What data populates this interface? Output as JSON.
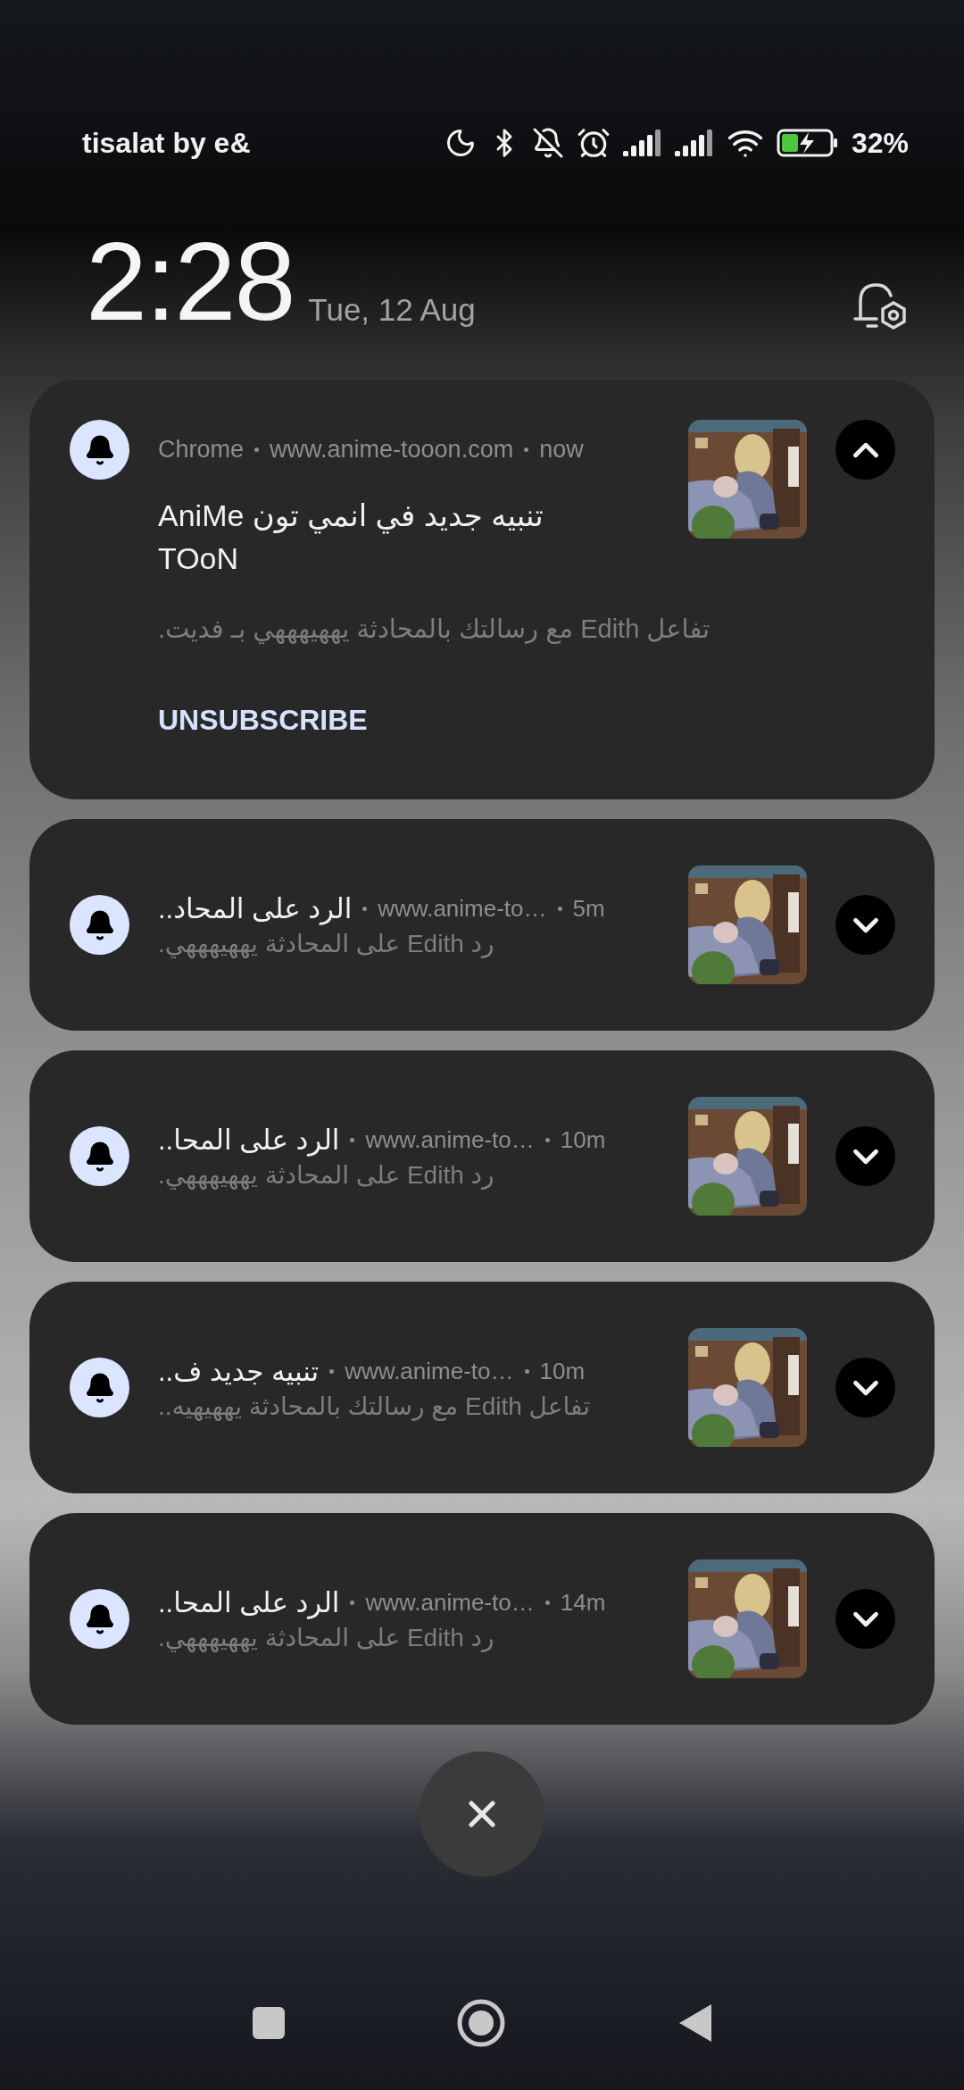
{
  "status_bar": {
    "carrier": "tisalat by e&",
    "battery": "32%"
  },
  "lock_header": {
    "time": "2:28",
    "date": "Tue, 12 Aug"
  },
  "notifications": [
    {
      "expanded": true,
      "app": "Chrome",
      "site": "www.anime-tooon.com",
      "time": "now",
      "title": "تنبيه جديد في انمي تون AniMe TOoN",
      "body": "تفاعل Edith مع رسالتك بالمحادثة يههيهههي بـ فديت.",
      "action": "UNSUBSCRIBE"
    },
    {
      "expanded": false,
      "title": "الرد على المحاد..",
      "site": "www.anime-to…",
      "time": "5m",
      "body": "رد Edith على المحادثة يههيهههي."
    },
    {
      "expanded": false,
      "title": "الرد على المحا..",
      "site": "www.anime-to…",
      "time": "10m",
      "body": "رد Edith على المحادثة يههيهههي."
    },
    {
      "expanded": false,
      "title": "تنبيه جديد ف..",
      "site": "www.anime-to…",
      "time": "10m",
      "body": "تفاعل Edith مع رسالتك بالمحادثة يههيهيه.."
    },
    {
      "expanded": false,
      "title": "الرد على المحا..",
      "site": "www.anime-to…",
      "time": "14m",
      "body": "رد Edith على المحادثة يههيهههي."
    }
  ]
}
